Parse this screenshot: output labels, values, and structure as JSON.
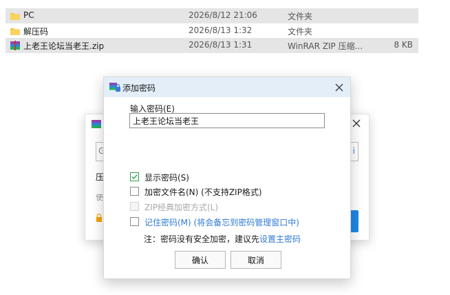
{
  "files": [
    {
      "name": "PC",
      "date": "2026/8/12 21:06",
      "type": "文件夹",
      "size": "",
      "icon": "folder-icon",
      "selected": true
    },
    {
      "name": "解压码",
      "date": "2026/8/13 1:32",
      "type": "文件夹",
      "size": "",
      "icon": "folder-icon",
      "selected": false
    },
    {
      "name": "上老王论坛当老王.zip",
      "date": "2026/8/13 1:31",
      "type": "WinRAR ZIP 压缩...",
      "size": "8 KB",
      "icon": "winrar-archive-icon",
      "selected": true
    }
  ],
  "back_dialog": {
    "field_left": "G",
    "field_right": "i",
    "text1": "压",
    "text2": "使"
  },
  "dialog": {
    "title": "添加密码",
    "password_label": "输入密码(E)",
    "password_value": "上老王论坛当老王",
    "checkboxes": [
      {
        "label": "显示密码(S)",
        "checked": true,
        "disabled": false
      },
      {
        "label": "加密文件名(N) (不支持ZIP格式)",
        "checked": false,
        "disabled": false
      },
      {
        "label": "ZIP经典加密方式(L)",
        "checked": false,
        "disabled": true
      },
      {
        "label": "记住密码(M) (将会备忘到密码管理窗口中)",
        "checked": false,
        "disabled": false
      }
    ],
    "note_prefix": "注：密码没有安全加密，建议先",
    "note_link": "设置主密码",
    "ok_label": "确认",
    "cancel_label": "取消"
  },
  "colors": {
    "titlebar": "#e3eef9",
    "link": "#2f7bd3",
    "check": "#2a9d4a",
    "selection": "#e5e5e5"
  }
}
